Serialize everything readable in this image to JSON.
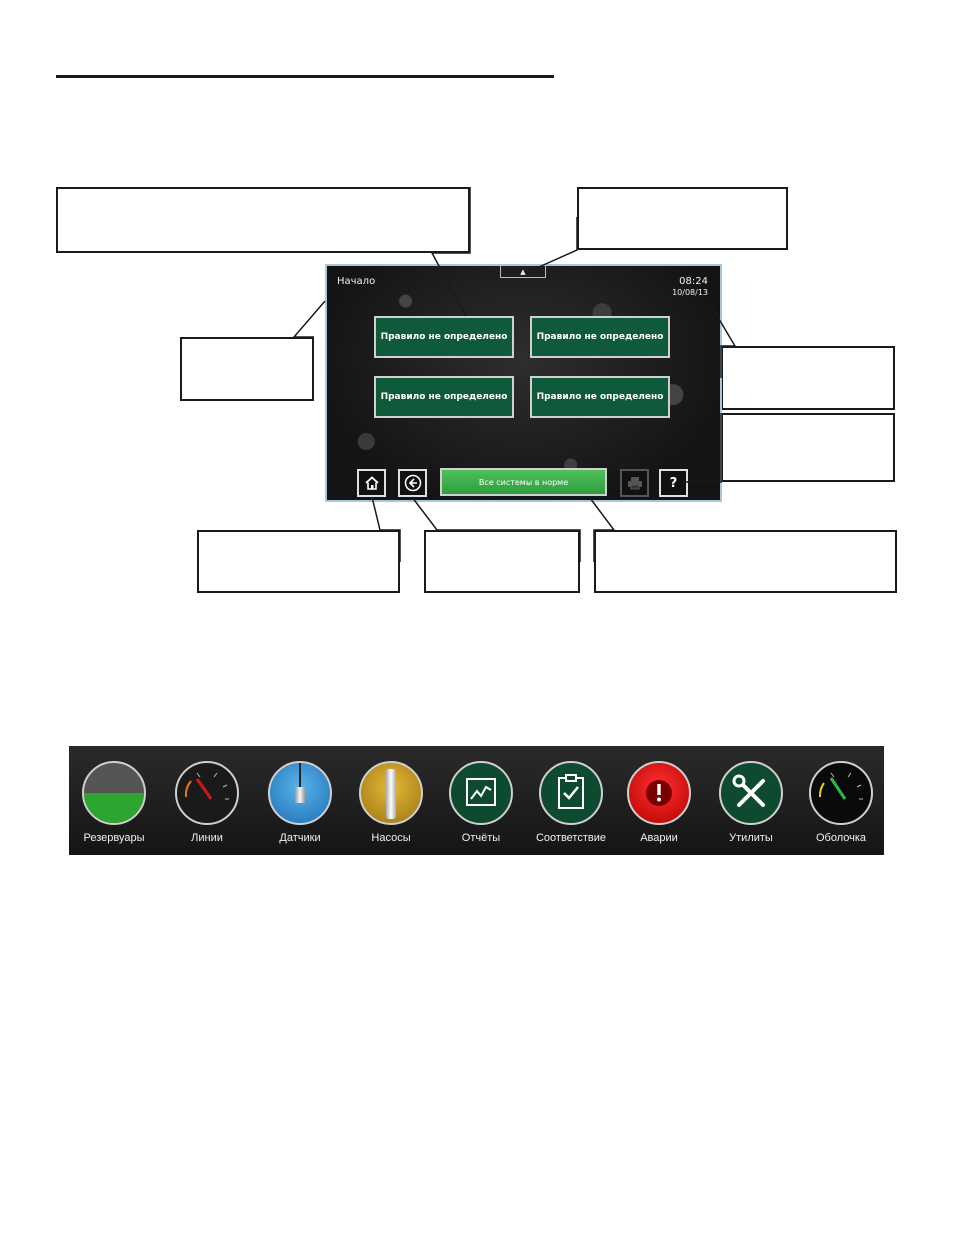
{
  "screen": {
    "title": "Начало",
    "time": "08:24",
    "date": "10/08/13",
    "top_tab_glyph": "▲",
    "rule_buttons": [
      "Правило не определено",
      "Правило не определено",
      "Правило не определено",
      "Правило не определено"
    ],
    "status": "Все системы в норме",
    "help_label": "?",
    "icons": {
      "home": "home-icon",
      "back": "back-arrow-icon",
      "print": "printer-icon",
      "help": "help-icon"
    }
  },
  "icon_bar": {
    "items": [
      {
        "label": "Резервуары",
        "icon": "tank-level-icon",
        "level": 0.5
      },
      {
        "label": "Линии",
        "icon": "line-gauge-icon"
      },
      {
        "label": "Датчики",
        "icon": "sensor-probe-icon"
      },
      {
        "label": "Насосы",
        "icon": "pump-icon"
      },
      {
        "label": "Отчёты",
        "icon": "report-chart-icon"
      },
      {
        "label": "Соответствие",
        "icon": "compliance-clipboard-icon"
      },
      {
        "label": "Аварии",
        "icon": "alarm-icon"
      },
      {
        "label": "Утилиты",
        "icon": "utilities-tools-icon"
      },
      {
        "label": "Оболочка",
        "icon": "shell-gauge-icon"
      }
    ]
  },
  "colors": {
    "rule_button": "#0f5a3a",
    "status_ok": "#3daf4c",
    "tank_fill": "#2ea530",
    "alarm_red": "#e01515",
    "screen_border": "#a8c8d8"
  }
}
